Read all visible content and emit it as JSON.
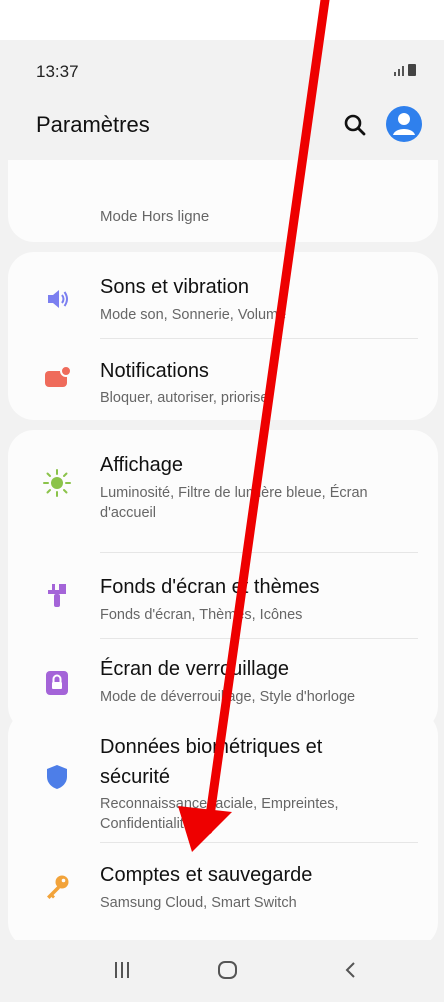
{
  "status": {
    "time": "13:37"
  },
  "header": {
    "title": "Paramètres"
  },
  "top_item": {
    "subtitle": "Mode Hors ligne"
  },
  "groups": [
    {
      "items": [
        {
          "title": "Sons et vibration",
          "subtitle": "Mode son, Sonnerie, Volume",
          "icon": "volume-icon",
          "color": "#7b7ff0"
        },
        {
          "title": "Notifications",
          "subtitle": "Bloquer, autoriser, prioriser",
          "icon": "notifications-icon",
          "color": "#ef6b5b"
        }
      ]
    },
    {
      "items": [
        {
          "title": "Affichage",
          "subtitle_lines": [
            "Luminosité, Filtre de lumière bleue, Écran",
            "d'accueil"
          ],
          "icon": "brightness-icon",
          "color": "#8bc34a"
        },
        {
          "title": "Fonds d'écran et thèmes",
          "subtitle": "Fonds d'écran, Thèmes, Icônes",
          "icon": "paintbrush-icon",
          "color": "#a464d8"
        },
        {
          "title": "Écran de verrouillage",
          "subtitle": "Mode de déverrouillage, Style d'horloge",
          "icon": "lock-icon",
          "color": "#a464d8"
        }
      ]
    },
    {
      "items": [
        {
          "title_lines": [
            "Données biométriques et",
            "sécurité"
          ],
          "subtitle_lines": [
            "Reconnaissance faciale, Empreintes,",
            "Confidentialité"
          ],
          "icon": "shield-icon",
          "color": "#4d7ee8"
        },
        {
          "title": "Comptes et sauvegarde",
          "subtitle": "Samsung Cloud, Smart Switch",
          "icon": "key-icon",
          "color": "#f2a33a"
        }
      ]
    }
  ],
  "colors": {
    "accent": "#2f80ed",
    "annotation_arrow": "#ee0000",
    "background": "#f2f2f2"
  }
}
